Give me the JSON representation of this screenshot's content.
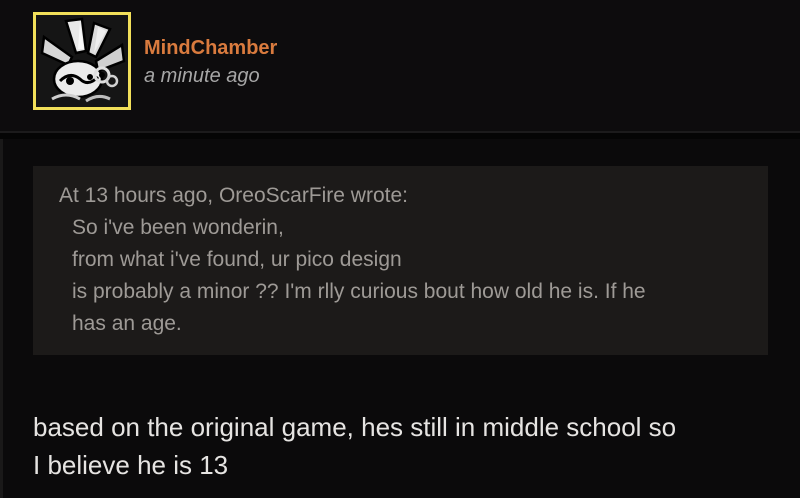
{
  "post": {
    "author": {
      "avatar_icon": "crystal-creature-avatar-icon",
      "username": "MindChamber",
      "username_color": "#d97b3e",
      "timestamp": "a minute ago"
    },
    "quote": {
      "attribution": "At 13 hours ago, OreoScarFire wrote:",
      "lines": [
        "So i've been wonderin,",
        "from what i've found, ur pico design",
        "is probably a minor ?? I'm rlly curious bout how old he is. If he",
        "has an age."
      ]
    },
    "body": {
      "lines": [
        "based on the original game, hes still in middle school so",
        "I believe he is 13"
      ]
    }
  },
  "colors": {
    "background": "#0b0a0b",
    "avatar_border": "#f2e05a",
    "quote_background": "#1c1a19",
    "quote_text": "#9e9a96",
    "body_text": "#e6e4e2",
    "timestamp_text": "#a6a6a6"
  }
}
